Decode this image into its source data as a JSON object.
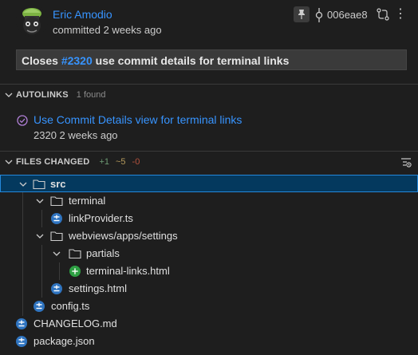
{
  "header": {
    "author": "Eric Amodio",
    "committed": "committed 2 weeks ago",
    "sha": "006eae8",
    "message_prefix": "Closes ",
    "message_issue": "#2320",
    "message_suffix": " use commit details for terminal links"
  },
  "autolinks": {
    "title": "AUTOLINKS",
    "count": "1 found",
    "item_title": "Use Commit Details view for terminal links",
    "item_sub": "2320 2 weeks ago"
  },
  "files_changed": {
    "title": "FILES CHANGED",
    "added": "+1",
    "modified": "~5",
    "deleted": "-0",
    "tree": [
      {
        "label": "src",
        "type": "folder"
      },
      {
        "label": "terminal",
        "type": "folder"
      },
      {
        "label": "linkProvider.ts",
        "type": "modified"
      },
      {
        "label": "webviews/apps/settings",
        "type": "folder"
      },
      {
        "label": "partials",
        "type": "folder"
      },
      {
        "label": "terminal-links.html",
        "type": "added"
      },
      {
        "label": "settings.html",
        "type": "modified"
      },
      {
        "label": "config.ts",
        "type": "modified"
      },
      {
        "label": "CHANGELOG.md",
        "type": "modified"
      },
      {
        "label": "package.json",
        "type": "modified"
      }
    ]
  },
  "colors": {
    "link": "#3794ff",
    "selected_row": "#04395e",
    "added": "#2ea043",
    "modified_badge": "#2f74c0",
    "stat_added": "#73c991",
    "stat_modified": "#e2c08d",
    "stat_deleted": "#c74e39"
  }
}
